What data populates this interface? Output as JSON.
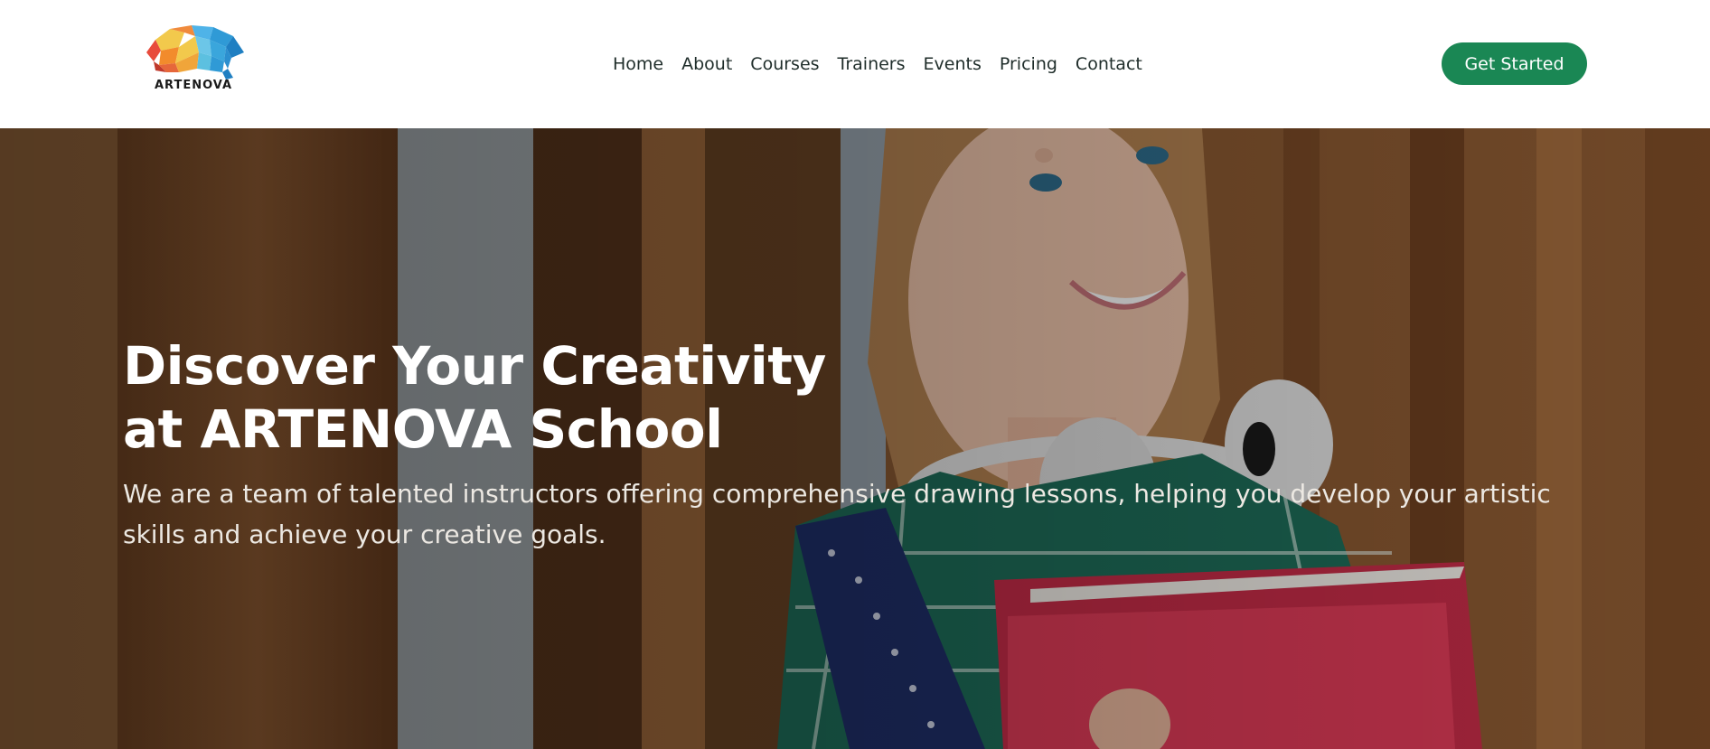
{
  "header": {
    "logo_text": "ARTENOVA",
    "nav": [
      {
        "label": "Home"
      },
      {
        "label": "About"
      },
      {
        "label": "Courses"
      },
      {
        "label": "Trainers"
      },
      {
        "label": "Events"
      },
      {
        "label": "Pricing"
      },
      {
        "label": "Contact"
      }
    ],
    "cta_label": "Get Started"
  },
  "hero": {
    "title_line1": "Discover Your Creativity",
    "title_line2": "at ARTENOVA School",
    "description": "We are a team of talented instructors offering comprehensive drawing lessons, helping you develop your artistic skills and achieve your creative goals.",
    "image_icon": "student-photo"
  },
  "colors": {
    "accent": "#1a8754",
    "header_bg": "#ffffff",
    "nav_text": "#1f2d2a",
    "hero_text": "#ffffff"
  }
}
